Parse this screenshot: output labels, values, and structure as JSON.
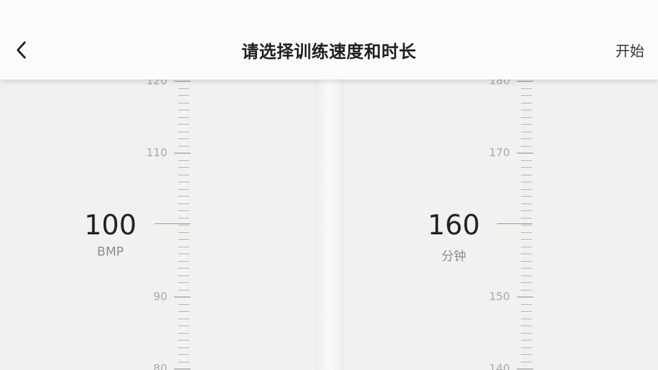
{
  "header": {
    "back_icon": "chevron-left-icon",
    "title": "请选择训练速度和时长",
    "start_label": "开始"
  },
  "speed_picker": {
    "value": "100",
    "unit": "BMP",
    "tick_labels": [
      "120",
      "110",
      "90",
      "80"
    ]
  },
  "duration_picker": {
    "value": "160",
    "unit": "分钟",
    "tick_labels": [
      "180",
      "170",
      "150",
      "140"
    ]
  },
  "colors": {
    "indicator": "#e8804a",
    "tick": "#b3b3b3",
    "label": "#a9a9a9"
  }
}
